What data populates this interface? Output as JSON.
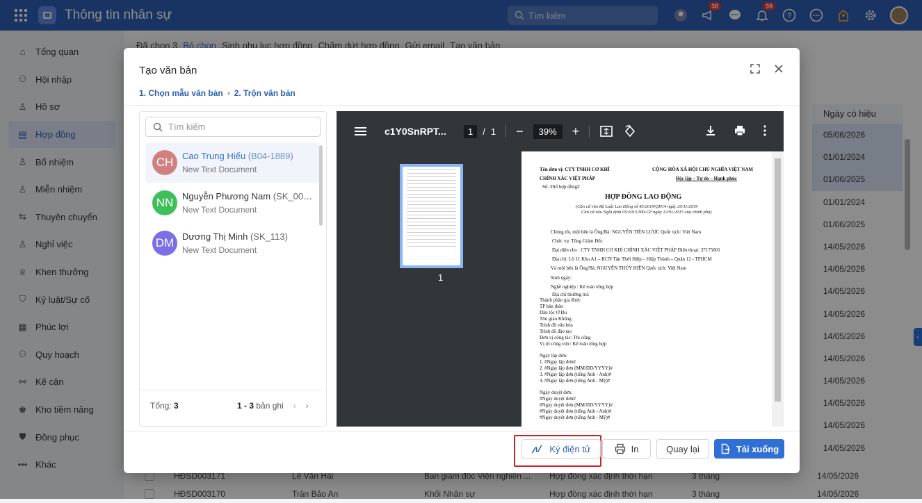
{
  "app": {
    "title": "Thông tin nhân sự",
    "search_placeholder": "Tìm kiếm",
    "notif_badge_1": "38",
    "notif_badge_2": "59"
  },
  "sidebar": {
    "items": [
      {
        "label": "Tổng quan"
      },
      {
        "label": "Hội nhập"
      },
      {
        "label": "Hồ sơ"
      },
      {
        "label": "Hợp đồng"
      },
      {
        "label": "Bổ nhiệm"
      },
      {
        "label": "Miễn nhiệm"
      },
      {
        "label": "Thuyên chuyển"
      },
      {
        "label": "Nghỉ việc"
      },
      {
        "label": "Khen thưởng"
      },
      {
        "label": "Kỷ luật/Sự cố"
      },
      {
        "label": "Phúc lợi"
      },
      {
        "label": "Quy hoạch"
      },
      {
        "label": "Kế cận"
      },
      {
        "label": "Kho tiềm năng"
      },
      {
        "label": "Đồng phục"
      },
      {
        "label": "Khác"
      }
    ],
    "active_index": 3
  },
  "background": {
    "toolbar": [
      "Đã chọn 3",
      "Bỏ chọn",
      "Sinh phụ lục hợp đồng",
      "Chấm dứt hợp đồng",
      "Gửi email",
      "Tạo văn bản"
    ],
    "column_header": "Ngày có hiệu",
    "dates": [
      "05/06/2026",
      "01/01/2024",
      "01/06/2025",
      "01/01/2024",
      "01/06/2025",
      "14/05/2026",
      "14/05/2026",
      "14/05/2026",
      "14/05/2026",
      "14/05/2026",
      "14/05/2026",
      "14/05/2026",
      "14/05/2026",
      "14/05/2026",
      "14/05/2026",
      "14/05/2026"
    ],
    "rows": [
      {
        "code": "HĐSD003171",
        "name": "Lê Văn Hải",
        "dept": "Ban giám đốc Viện nghiên ...",
        "type": "Hợp đồng xác định thời hạn",
        "term": "3 tháng",
        "date": "14/05/2026"
      },
      {
        "code": "HĐSD003170",
        "name": "Trần Bảo An",
        "dept": "Khối Nhân sự",
        "type": "Hợp đồng xác định thời hạn",
        "term": "3 tháng",
        "date": "14/05/2026"
      }
    ]
  },
  "modal": {
    "title": "Tạo văn bản",
    "step1": "1. Chọn mẫu văn bản",
    "step2": "2. Trộn văn bản",
    "search_placeholder": "Tìm kiếm",
    "people": [
      {
        "initials": "CH",
        "color": "#d27f7f",
        "name": "Cao Trung Hiếu",
        "code": "(B04-1889)",
        "sub": "New Text Document"
      },
      {
        "initials": "NN",
        "color": "#3fbf5a",
        "name": "Nguyễn Phương Nam",
        "code": "(SK_008...",
        "sub": "New Text Document"
      },
      {
        "initials": "DM",
        "color": "#7b6ee6",
        "name": "Dương Thị Minh",
        "code": "(SK_113)",
        "sub": "New Text Document"
      }
    ],
    "total_label": "Tổng:",
    "total_value": "3",
    "range": "1 - 3",
    "range_suffix": "bản ghi",
    "buttons": {
      "sign": "Ký điện tử",
      "print": "In",
      "back": "Quay lại",
      "download": "Tải xuống"
    }
  },
  "pdf": {
    "filename": "c1Y0SnRPT...",
    "page_current": "1",
    "page_sep": "/",
    "page_total": "1",
    "zoom": "39%",
    "thumb_label": "1",
    "doc_lines": [
      "Tên đơn vị: CTY TNHH CƠ KHÍ",
      "CỘNG HÒA XÃ HỘI CHỦ NGHĨA VIỆT NAM",
      "CHÍNH XÁC VIỆT PHÁP",
      "Độc lập – Tự do – Hạnh phúc",
      "Số: #Số hợp đồng#",
      "HỢP ĐỒNG LAO ĐỘNG",
      "(Căn cứ vào Bộ Luật Lao Động số 45/2019/QH14 ngày 20/11/2019",
      "Căn cứ vào Nghị định 05/2015/NĐ-CP ngày 12/01/2015 của chính phủ)",
      "Chúng tôi, một bên là Ông/Bà:  NGUYỄN TIẾN LƯỢC   Quốc tịch: Việt Nam",
      "Chức vụ:   Tổng Giám Đốc",
      "Đại diện cho : CTY TNHH CƠ KHÍ CHÍNH XÁC VIỆT PHÁP   Điện thoại: 37175001",
      "Địa chỉ: Lô 11 Khu A1 – KCN Tân Thới Hiệp – Hiệp Thành – Quận 12 - TPHCM",
      "Và một bên là Ông/Bà:  NGUYỄN THÚY HIỀN   Quốc tịch: Việt Nam",
      "Sinh ngày:",
      "Nghề nghiệp :   Kế toán tổng hợp",
      "Địa chỉ thường trú:",
      "Thành phần gia đình:",
      "TP bản thân",
      "Dân tộc  Ơ Đu",
      "Tôn giáo Không",
      "Trình độ văn hóa",
      "Trình độ đào tạo",
      "Đơn vị công tác: Thi công",
      "Vị trí công việc: Kế toán tổng hợp",
      "Ngày lập đơn:",
      "1. #Ngày lập đơn#",
      "2. #Ngày lập đơn (MM/DD/YYYY)#",
      "3. #Ngày lập đơn (tiếng Anh - Anh)#",
      "4. #Ngày lập đơn (tiếng Anh - Mỹ)#",
      "Ngày duyệt đơn:",
      "#Ngày duyệt đơn#",
      "#Ngày duyệt đơn (MM/DD/YYYY)#",
      "#Ngày duyệt đơn (tiếng Anh - Anh)#",
      "#Ngày duyệt đơn (tiếng Anh - Mỹ)#"
    ]
  }
}
